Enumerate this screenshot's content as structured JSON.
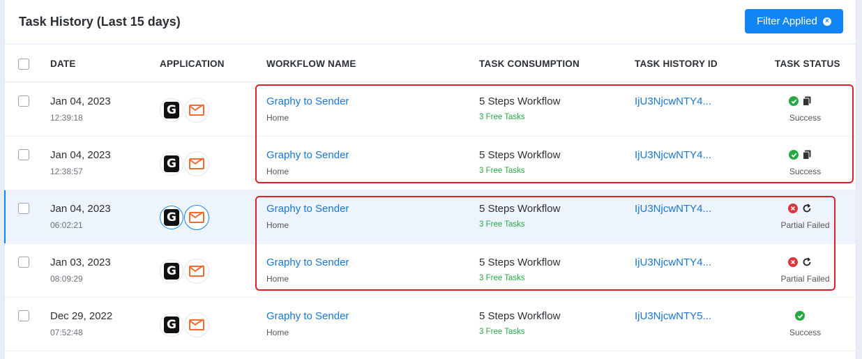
{
  "header": {
    "title": "Task History (Last 15 days)",
    "filter_button": "Filter Applied"
  },
  "columns": {
    "date": "DATE",
    "application": "APPLICATION",
    "workflow_name": "WORKFLOW NAME",
    "task_consumption": "TASK CONSUMPTION",
    "task_history_id": "TASK HISTORY ID",
    "task_status": "TASK STATUS"
  },
  "colors": {
    "accent": "#1285f5",
    "link": "#1976d2",
    "success": "#27a844",
    "failed": "#d9363e",
    "highlight": "#e0202b"
  },
  "rows": [
    {
      "date": "Jan 04, 2023",
      "time": "12:39:18",
      "apps": [
        "graphy-icon",
        "sender-icon"
      ],
      "workflow": "Graphy to Sender",
      "folder": "Home",
      "steps": "5 Steps Workflow",
      "free_tasks": "3 Free Tasks",
      "history_id": "IjU3NjcwNTY4...",
      "status": "Success",
      "status_icons": [
        "check-circle-icon",
        "copy-icon"
      ]
    },
    {
      "date": "Jan 04, 2023",
      "time": "12:38:57",
      "apps": [
        "graphy-icon",
        "sender-icon"
      ],
      "workflow": "Graphy to Sender",
      "folder": "Home",
      "steps": "5 Steps Workflow",
      "free_tasks": "3 Free Tasks",
      "history_id": "IjU3NjcwNTY4...",
      "status": "Success",
      "status_icons": [
        "check-circle-icon",
        "copy-icon"
      ]
    },
    {
      "date": "Jan 04, 2023",
      "time": "06:02:21",
      "apps": [
        "graphy-icon",
        "sender-icon"
      ],
      "workflow": "Graphy to Sender",
      "folder": "Home",
      "steps": "5 Steps Workflow",
      "free_tasks": "3 Free Tasks",
      "history_id": "IjU3NjcwNTY4...",
      "status": "Partial Failed",
      "status_icons": [
        "error-circle-icon",
        "retry-icon"
      ]
    },
    {
      "date": "Jan 03, 2023",
      "time": "08:09:29",
      "apps": [
        "graphy-icon",
        "sender-icon"
      ],
      "workflow": "Graphy to Sender",
      "folder": "Home",
      "steps": "5 Steps Workflow",
      "free_tasks": "3 Free Tasks",
      "history_id": "IjU3NjcwNTY4...",
      "status": "Partial Failed",
      "status_icons": [
        "error-circle-icon",
        "retry-icon"
      ]
    },
    {
      "date": "Dec 29, 2022",
      "time": "07:52:48",
      "apps": [
        "graphy-icon",
        "sender-icon"
      ],
      "workflow": "Graphy to Sender",
      "folder": "Home",
      "steps": "5 Steps Workflow",
      "free_tasks": "3 Free Tasks",
      "history_id": "IjU3NjcwNTY5...",
      "status": "Success",
      "status_icons": [
        "check-circle-icon"
      ]
    }
  ]
}
